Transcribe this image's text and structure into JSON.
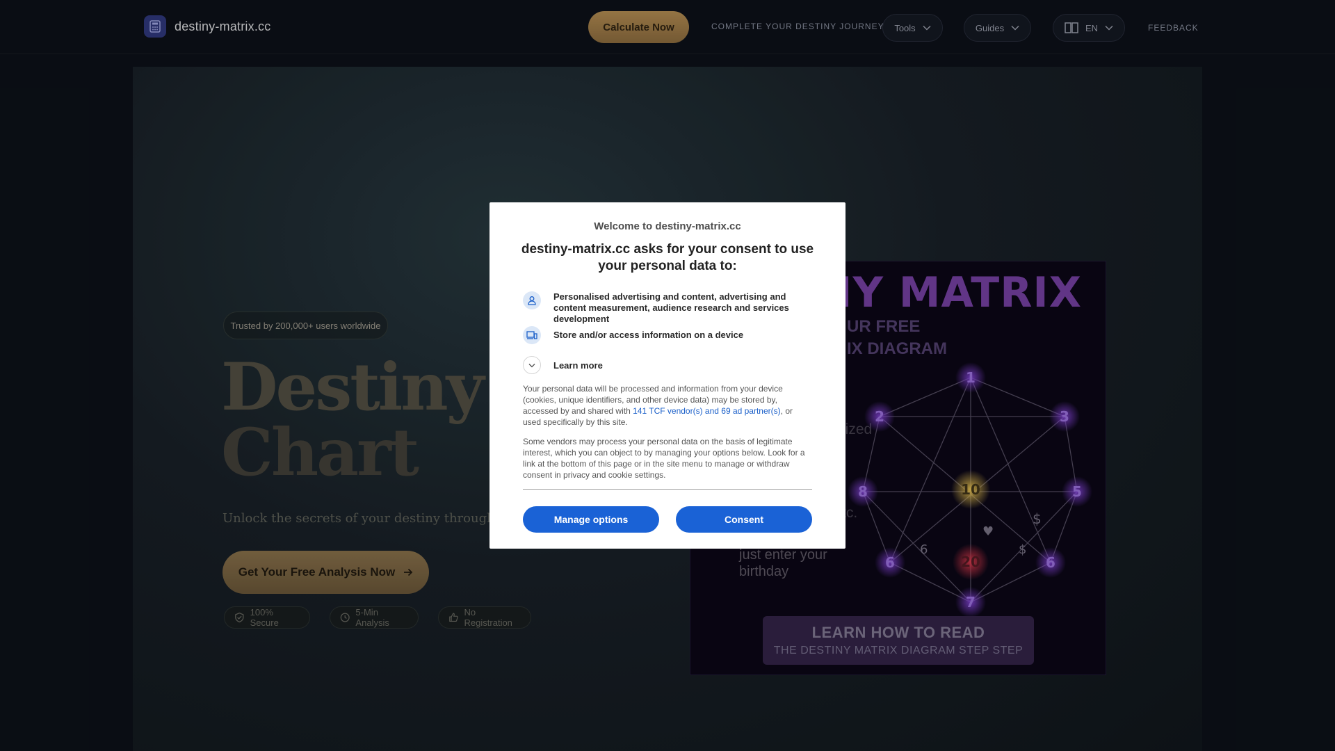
{
  "nav": {
    "logo_text": "destiny-matrix.cc",
    "calc_label": "Calculate Now",
    "journey_label": "COMPLETE YOUR DESTINY JOURNEY",
    "tools_label": "Tools",
    "guides_label": "Guides",
    "lang_label": "EN",
    "feedback_label": "FEEDBACK"
  },
  "hero": {
    "trusted": "Trusted by 200,000+ users worldwide",
    "title_line1": "Destiny M",
    "title_line2": "Chart",
    "subtitle": "Unlock the secrets of your destiny through our exp",
    "cta_label": "Get Your Free Analysis Now",
    "badges": [
      {
        "label": "100% Secure",
        "icon": "shield-check-icon"
      },
      {
        "label": "5-Min Analysis",
        "icon": "clock-icon"
      },
      {
        "label": "No Registration",
        "icon": "thumbs-up-icon"
      }
    ]
  },
  "matrix_image": {
    "title": "NY MATRIX",
    "free_line1": "UR FREE",
    "free_line2": "IX DIAGRAM",
    "side1": "lized",
    "side2": "tc.",
    "enter_line1": "just enter your",
    "enter_line2": "birthday",
    "learn_line1": "LEARN HOW TO READ",
    "learn_line2": "THE DESTINY MATRIX DIAGRAM STEP STEP",
    "nodes": {
      "n1": "1",
      "n2": "2",
      "n3": "3",
      "n5": "5",
      "n8": "8",
      "n10": "10",
      "n6a": "6",
      "n6b": "6",
      "n6c": "6",
      "n20": "20",
      "n7": "7",
      "d1": "$",
      "d2": "$",
      "heart": "♥"
    }
  },
  "consent": {
    "welcome": "Welcome to destiny-matrix.cc",
    "heading": "destiny-matrix.cc asks for your consent to use your personal data to:",
    "purpose1": "Personalised advertising and content, advertising and content measurement, audience research and services development",
    "purpose2": "Store and/or access information on a device",
    "learn_more": "Learn more",
    "para1_a": "Your personal data will be processed and information from your device (cookies, unique identifiers, and other device data) may be stored by, accessed by and shared with ",
    "para1_link": "141 TCF vendor(s) and 69 ad partner(s)",
    "para1_b": ", or used specifically by this site.",
    "para2": "Some vendors may process your personal data on the basis of legitimate interest, which you can object to by managing your options below. Look for a link at the bottom of this page or in the site menu to manage or withdraw consent in privacy and cookie settings.",
    "manage_label": "Manage options",
    "consent_label": "Consent"
  },
  "colors": {
    "accent_gold": "#a17e4a",
    "consent_blue": "#1a62d6",
    "matrix_purple": "#6a3a92"
  }
}
